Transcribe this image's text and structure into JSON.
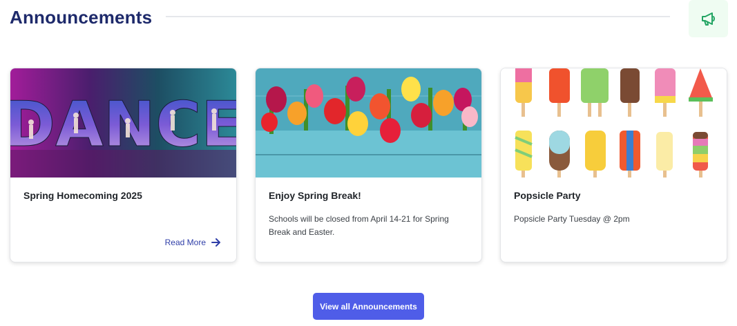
{
  "header": {
    "title": "Announcements",
    "icon": "megaphone-icon",
    "icon_color": "#22a463"
  },
  "cards": [
    {
      "title": "Spring Homecoming 2025",
      "body": "",
      "image_text": "DANCE",
      "link": "Read More"
    },
    {
      "title": "Enjoy Spring Break!",
      "body": "Schools will be closed from April 14-21 for Spring Break and Easter.",
      "link": ""
    },
    {
      "title": "Popsicle Party",
      "body": "Popsicle Party Tuesday @ 2pm",
      "link": ""
    }
  ],
  "view_all": {
    "label": "View all Announcements"
  },
  "colors": {
    "title": "#1e2a6b",
    "accent": "#4f5de8",
    "link": "#2f3ea8"
  }
}
